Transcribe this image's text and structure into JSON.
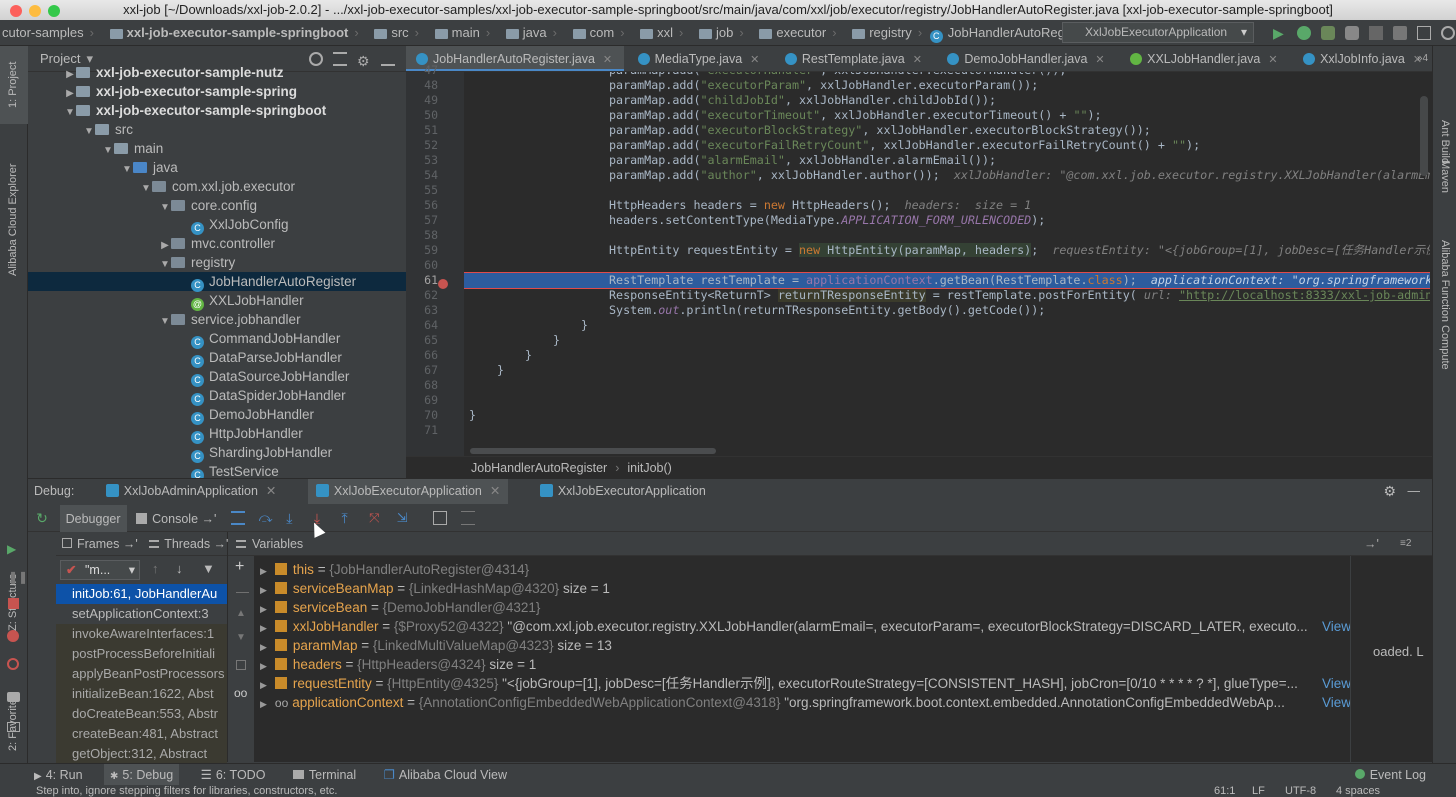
{
  "window": {
    "title": "xxl-job [~/Downloads/xxl-job-2.0.2] - .../xxl-job-executor-samples/xxl-job-executor-sample-springboot/src/main/java/com/xxl/job/executor/registry/JobHandlerAutoRegister.java [xxl-job-executor-sample-springboot]"
  },
  "navbar": {
    "crumbs": [
      "cutor-samples",
      "xxl-job-executor-sample-springboot",
      "src",
      "main",
      "java",
      "com",
      "xxl",
      "job",
      "executor",
      "registry",
      "JobHandlerAutoRegister"
    ],
    "run_config": "XxlJobExecutorApplication"
  },
  "left_strip": {
    "project": "1: Project",
    "cloud": "Alibaba Cloud Explorer",
    "structure": "Z: Structure",
    "favorites": "2: Favorites"
  },
  "right_strip": {
    "ant": "Ant Build",
    "maven": "Maven",
    "fc": "Alibaba Function Compute"
  },
  "project": {
    "title": "Project",
    "tree": [
      {
        "label": "xxl-job-executor-sample-nutz",
        "bold": true
      },
      {
        "label": "xxl-job-executor-sample-spring",
        "bold": true
      },
      {
        "label": "xxl-job-executor-sample-springboot",
        "bold": true
      },
      {
        "label": "src"
      },
      {
        "label": "main"
      },
      {
        "label": "java"
      },
      {
        "label": "com.xxl.job.executor"
      },
      {
        "label": "core.config"
      },
      {
        "label": "XxlJobConfig"
      },
      {
        "label": "mvc.controller"
      },
      {
        "label": "registry"
      },
      {
        "label": "JobHandlerAutoRegister"
      },
      {
        "label": "XXLJobHandler"
      },
      {
        "label": "service.jobhandler"
      },
      {
        "label": "CommandJobHandler"
      },
      {
        "label": "DataParseJobHandler"
      },
      {
        "label": "DataSourceJobHandler"
      },
      {
        "label": "DataSpiderJobHandler"
      },
      {
        "label": "DemoJobHandler"
      },
      {
        "label": "HttpJobHandler"
      },
      {
        "label": "ShardingJobHandler"
      },
      {
        "label": "TestService"
      }
    ]
  },
  "editor": {
    "tabs": [
      "JobHandlerAutoRegister.java",
      "MediaType.java",
      "RestTemplate.java",
      "DemoJobHandler.java",
      "XXLJobHandler.java",
      "XxlJobInfo.java"
    ],
    "tab_count": "4",
    "line_numbers": [
      "47",
      "48",
      "49",
      "50",
      "51",
      "52",
      "53",
      "54",
      "55",
      "56",
      "57",
      "58",
      "59",
      "60",
      "61",
      "62",
      "63",
      "64",
      "65",
      "66",
      "67",
      "68",
      "69",
      "70",
      "71"
    ],
    "breadcrumb": [
      "JobHandlerAutoRegister",
      "initJob()"
    ]
  },
  "debug": {
    "label": "Debug:",
    "sessions": [
      "XxlJobAdminApplication",
      "XxlJobExecutorApplication",
      "XxlJobExecutorApplication"
    ],
    "debugger_tab": "Debugger",
    "console_tab": "Console",
    "frames_label": "Frames",
    "threads_label": "Threads",
    "variables_label": "Variables",
    "thread_filter": "\"m...",
    "frames": [
      "initJob:61, JobHandlerAu",
      "setApplicationContext:3",
      "invokeAwareInterfaces:1",
      "postProcessBeforeInitiali",
      "applyBeanPostProcessors",
      "initializeBean:1622, Abst",
      "doCreateBean:553, Abstr",
      "createBean:481, Abstract",
      "getObject:312, Abstract"
    ],
    "variables": [
      {
        "name": "this",
        "type": "{JobHandlerAutoRegister@4314}",
        "value": "",
        "link": ""
      },
      {
        "name": "serviceBeanMap",
        "type": "{LinkedHashMap@4320}",
        "value": " size = 1",
        "link": ""
      },
      {
        "name": "serviceBean",
        "type": "{DemoJobHandler@4321}",
        "value": "",
        "link": ""
      },
      {
        "name": "xxlJobHandler",
        "type": "{$Proxy52@4322}",
        "value": " \"@com.xxl.job.executor.registry.XXLJobHandler(alarmEmail=, executorParam=, executorBlockStrategy=DISCARD_LATER, executo...",
        "link": "View"
      },
      {
        "name": "paramMap",
        "type": "{LinkedMultiValueMap@4323}",
        "value": " size = 13",
        "link": ""
      },
      {
        "name": "headers",
        "type": "{HttpHeaders@4324}",
        "value": " size = 1",
        "link": ""
      },
      {
        "name": "requestEntity",
        "type": "{HttpEntity@4325}",
        "value": " \"<{jobGroup=[1], jobDesc=[任务Handler示例], executorRouteStrategy=[CONSISTENT_HASH], jobCron=[0/10 * * * * ? *], glueType=...",
        "link": "View"
      },
      {
        "name": "applicationContext",
        "type": "{AnnotationConfigEmbeddedWebApplicationContext@4318}",
        "value": " \"org.springframework.boot.context.embedded.AnnotationConfigEmbeddedWebAp...",
        "link": "View"
      }
    ],
    "side_text": "oaded. L",
    "panel_count": "2"
  },
  "bottombar": {
    "run": "4: Run",
    "debug": "5: Debug",
    "todo": "6: TODO",
    "terminal": "Terminal",
    "cloud": "Alibaba Cloud View",
    "event_log": "Event Log"
  },
  "status": {
    "message": "Step into, ignore stepping filters for libraries, constructors, etc.",
    "position": "61:1",
    "lf": "LF",
    "encoding": "UTF-8",
    "indent": "4 spaces"
  }
}
